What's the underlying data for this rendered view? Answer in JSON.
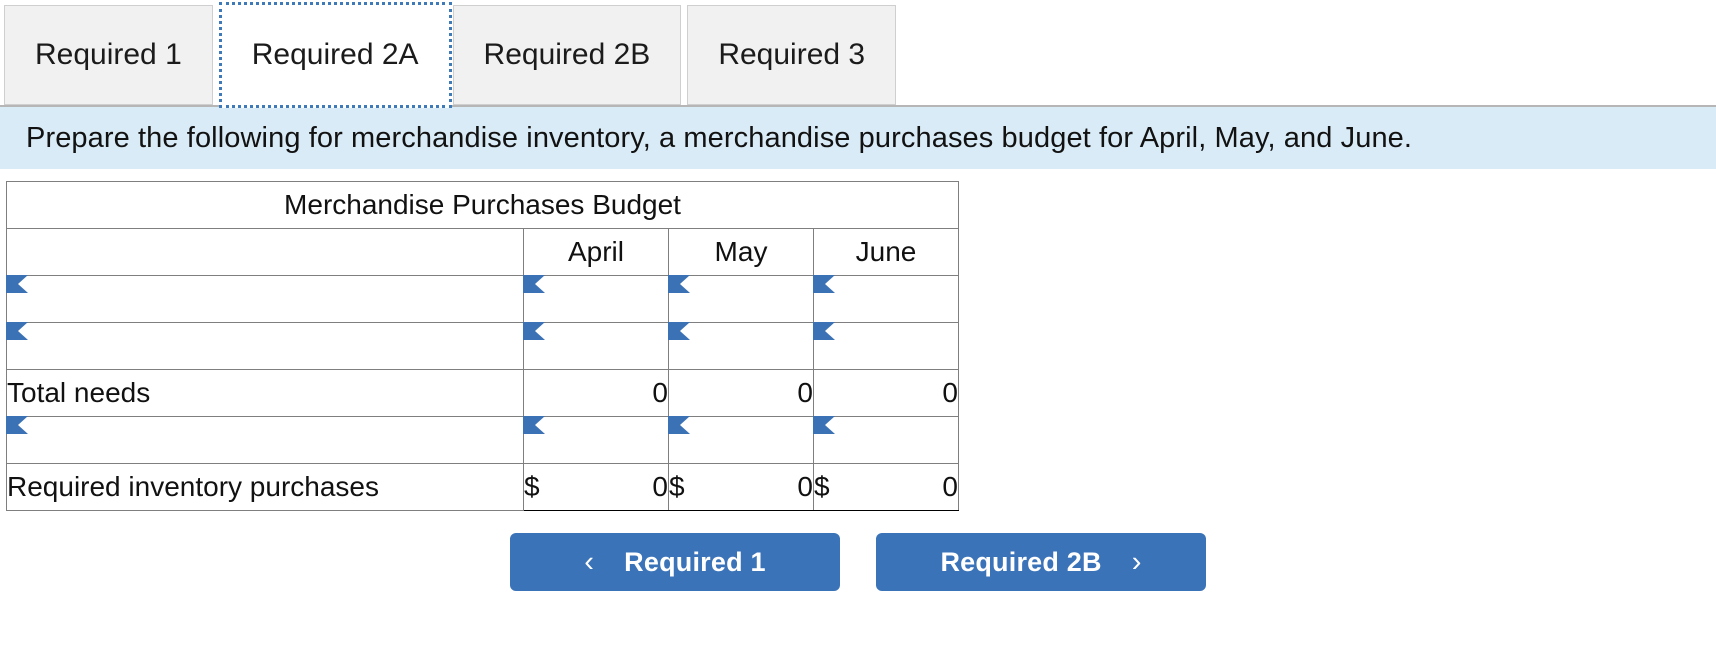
{
  "tabs": [
    {
      "label": "Required 1",
      "active": false
    },
    {
      "label": "Required 2A",
      "active": true
    },
    {
      "label": "Required 2B",
      "active": false
    },
    {
      "label": "Required 3",
      "active": false
    }
  ],
  "instruction": {
    "text": "Prepare the following for merchandise inventory, a merchandise purchases budget for April, May, and June."
  },
  "table": {
    "title": "Merchandise Purchases Budget",
    "blank_header": "",
    "columns": [
      "April",
      "May",
      "June"
    ],
    "rows": [
      {
        "type": "editable",
        "label": "",
        "values": [
          "",
          "",
          ""
        ]
      },
      {
        "type": "editable",
        "label": "",
        "values": [
          "",
          "",
          ""
        ]
      },
      {
        "type": "total",
        "label": "Total needs",
        "values": [
          "0",
          "0",
          "0"
        ]
      },
      {
        "type": "editable",
        "label": "",
        "values": [
          "",
          "",
          ""
        ]
      },
      {
        "type": "money",
        "label": "Required inventory purchases",
        "currency": "$",
        "values": [
          "0",
          "0",
          "0"
        ]
      }
    ]
  },
  "footer": {
    "prev_button": {
      "label": "Required 1",
      "chevron": "‹"
    },
    "next_button": {
      "label": "Required 2B",
      "chevron": "›"
    }
  },
  "colors": {
    "header_blue": "#76a9e0",
    "instruction_blue": "#d9ebf7",
    "button_blue": "#3b73b9",
    "input_border": "#4a82c3",
    "focus_outline": "#3e79b8"
  }
}
